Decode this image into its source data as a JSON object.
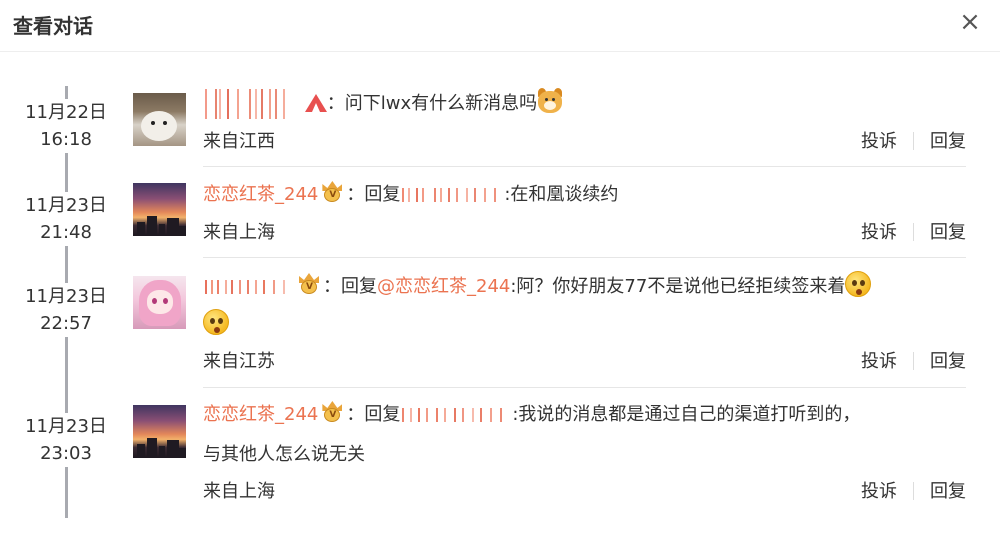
{
  "dialog": {
    "title": "查看对话",
    "close_glyph": "×"
  },
  "entries": [
    {
      "date": "11月22日",
      "time": "16:18",
      "user_redacted": true,
      "sep": "：",
      "text": "问下lwx有什么新消息吗",
      "emoji": "dog-emoji",
      "source": "来自江西",
      "report": "投诉",
      "reply": "回复"
    },
    {
      "date": "11月23日",
      "time": "21:48",
      "user": "恋恋红茶_244",
      "sep": "：",
      "reply_prefix": "回复",
      "text": ":在和凰谈续约",
      "source": "来自上海",
      "report": "投诉",
      "reply": "回复"
    },
    {
      "date": "11月23日",
      "time": "22:57",
      "user_redacted": true,
      "sep": "：",
      "reply_prefix": "回复",
      "mention": "@恋恋红茶_244",
      "text": ":阿？你好朋友77不是说他已经拒续签来着",
      "emoji": "surprised-emoji",
      "source": "来自江苏",
      "report": "投诉",
      "reply": "回复"
    },
    {
      "date": "11月23日",
      "time": "23:03",
      "user": "恋恋红茶_244",
      "sep": "：",
      "reply_prefix": "回复",
      "text": ":我说的消息都是通过自己的渠道打听到的，",
      "text2": "与其他人怎么说无关",
      "source": "来自上海",
      "report": "投诉",
      "reply": "回复"
    }
  ],
  "colors": {
    "username": "#eb7350",
    "text": "#333333",
    "timeline": "#a8aab0",
    "divider": "#e6e6e6"
  }
}
